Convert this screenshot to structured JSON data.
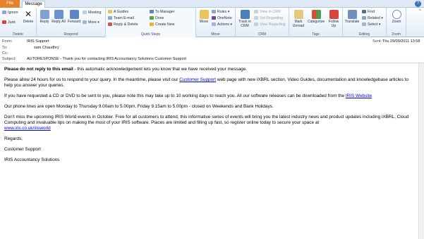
{
  "tabs": {
    "file": "File",
    "message": "Message"
  },
  "ribbon": {
    "delete": {
      "ignore": "Ignore",
      "junk": "Junk",
      "delete": "Delete",
      "label": "Delete"
    },
    "respond": {
      "reply": "Reply",
      "reply_all": "Reply All",
      "forward": "Forward",
      "meeting": "Meeting",
      "more": "More",
      "label": "Respond"
    },
    "quick_steps": {
      "items": [
        "A Guides",
        "Team E-mail",
        "Reply & Delete",
        "To Manager",
        "Done",
        "Create New"
      ],
      "label": "Quick Steps"
    },
    "move": {
      "move": "Move",
      "rules": "Rules",
      "onenote": "OneNote",
      "actions": "Actions",
      "label": "Move"
    },
    "crm": {
      "track": "Track in CRM",
      "view": "View in CRM",
      "set_regarding": "Set Regarding",
      "view_regarding": "View Regarding",
      "label": "CRM"
    },
    "tags": {
      "unread": "Mark Unread",
      "categorize": "Categorize",
      "follow": "Follow Up",
      "label": "Tags"
    },
    "editing": {
      "translate": "Translate",
      "find": "Find",
      "related": "Related",
      "select": "Select",
      "label": "Editing"
    },
    "zoom": {
      "zoom": "Zoom",
      "label": "Zoom"
    }
  },
  "header": {
    "from_label": "From:",
    "from": "IRIS Support",
    "to_label": "To:",
    "to": "sam Chaudhry",
    "cc_label": "Cc:",
    "subject_label": "Subject:",
    "subject": "AUTORESPONSE - Thank you for contacting IRIS Accountancy Solutions Customer Support",
    "sent_label": "Sent:",
    "sent": "Thu 29/09/2011 13:58"
  },
  "body": {
    "p1_bold": "Please do not reply to this email",
    "p1_rest": " - this automatic acknowledgement lets you know that we have received your message.",
    "p2a": "Please allow 24 hours for us to respond to your query.  In the meantime, please visit our ",
    "p2_link": "Customer Support",
    "p2b": " web page with new iXBRL section, Video Guides, documentation and  knowledgebase articles to help you answer your queries.",
    "p3a": "If you have requested a CD or DVD to be sent to you, please note this may take up to 10 working days to reach you.  All our software releases can be downloaded from the ",
    "p3_link": "IRIS Website",
    "p4": "Our phone lines are open Monday to Thursday 9.00am to 5.00pm, Friday 9.15am to 5.00pm - closed on Weekends and Bank Holidays.",
    "p5": "Don't miss the upcoming IRIS World events in October.  Free for all customers to attend, this informative series of events will bring you the latest industry news and product updates including iXBRL, Cloud Computing and invaluable tips on making the most of your IRIS software. Places are limited and filling up fast, so register online today to secure your space at",
    "p5_link": "www.iris.co.uk/irisworld",
    "regards": "Regards,",
    "sig1": "Customer Support",
    "sig2": "IRIS Accountancy Solutions"
  }
}
